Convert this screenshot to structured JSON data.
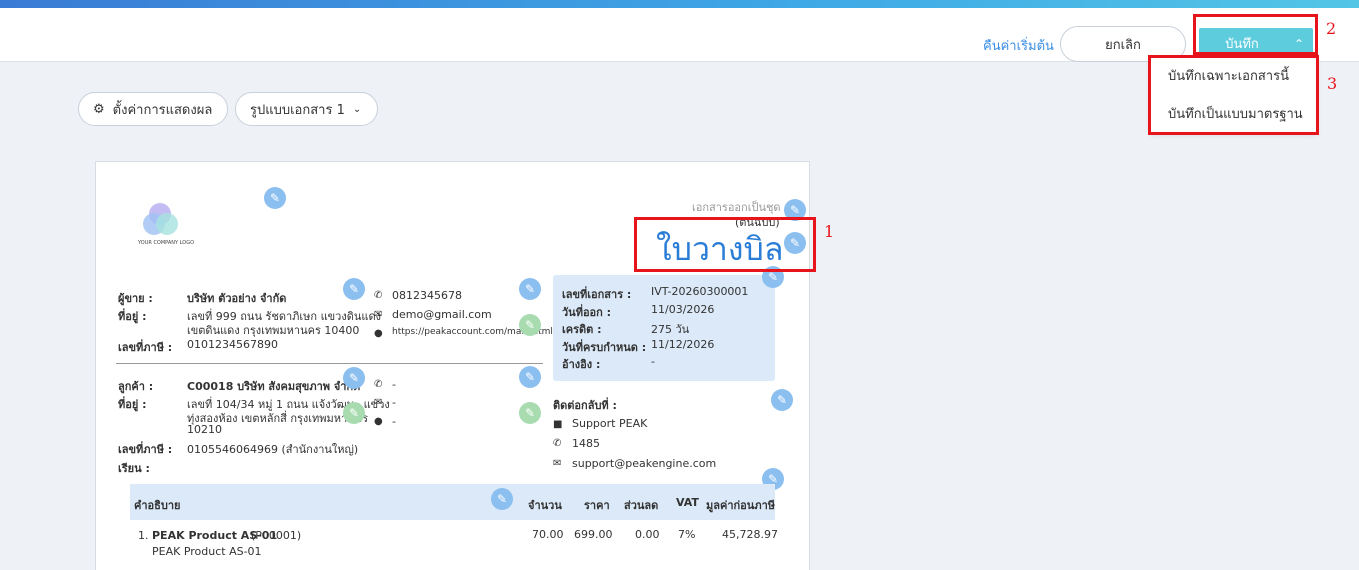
{
  "header": {
    "reset_label": "คืนค่าเริ่มต้น",
    "cancel_label": "ยกเลิก",
    "save_label": "บันทึก"
  },
  "save_menu": [
    "บันทึกเฉพาะเอกสารนี้",
    "บันทึกเป็นแบบมาตรฐาน"
  ],
  "toolbar": {
    "display_settings": "ตั้งค่าการแสดงผล",
    "template": "รูปแบบเอกสาร 1"
  },
  "annotations": [
    "1",
    "2",
    "3"
  ],
  "document": {
    "logo_text": "YOUR COMPANY LOGO",
    "issued_as_set": "เอกสารออกเป็นชุด",
    "original": "(ต้นฉบับ)",
    "title": "ใบวางบิล",
    "seller": {
      "label": "ผู้ขาย :",
      "name": "บริษัท ตัวอย่าง จำกัด",
      "address_label": "ที่อยู่ :",
      "address_line1": "เลขที่ 999 ถนน รัชดาภิเษก แขวงดินแดง",
      "address_line2": "เขตดินแดง กรุงเทพมหานคร 10400",
      "tax_label": "เลขที่ภาษี :",
      "tax_id": "0101234567890",
      "phone": "0812345678",
      "email": "demo@gmail.com",
      "website": "https://peakaccount.com/main.html"
    },
    "customer": {
      "label": "ลูกค้า :",
      "name": "C00018 บริษัท สังคมสุขภาพ จำกัด",
      "address_label": "ที่อยู่ :",
      "address_line1": "เลขที่ 104/34 หมู่ 1 ถนน แจ้งวัฒนะ แขวง",
      "address_line2": "ทุ่งสองห้อง เขตหลักสี่ กรุงเทพมหานคร",
      "address_line3": "10210",
      "tax_label": "เลขที่ภาษี :",
      "tax_id": "0105546064969 (สำนักงานใหญ่)",
      "attention_label": "เรียน :",
      "phone": "-",
      "email": "-",
      "website": "-"
    },
    "info": {
      "doc_no_label": "เลขที่เอกสาร :",
      "doc_no": "IVT-20260300001",
      "issue_date_label": "วันที่ออก :",
      "issue_date": "11/03/2026",
      "credit_label": "เครดิต :",
      "credit": "275 วัน",
      "due_label": "วันที่ครบกำหนด :",
      "due": "11/12/2026",
      "ref_label": "อ้างอิง :",
      "ref": "-"
    },
    "contact": {
      "label": "ติดต่อกลับที่ :",
      "name": "Support PEAK",
      "phone": "1485",
      "email": "support@peakengine.com"
    },
    "table": {
      "headers": [
        "คำอธิบาย",
        "จำนวน",
        "ราคา",
        "ส่วนลด",
        "VAT",
        "มูลค่าก่อนภาษี"
      ],
      "rows": [
        {
          "no": "1.",
          "name": "PEAK Product AS-01",
          "code": "(P00001)",
          "subname": "PEAK Product AS-01",
          "qty": "70.00",
          "price": "699.00",
          "discount": "0.00",
          "vat": "7%",
          "amount": "45,728.97"
        }
      ]
    }
  }
}
